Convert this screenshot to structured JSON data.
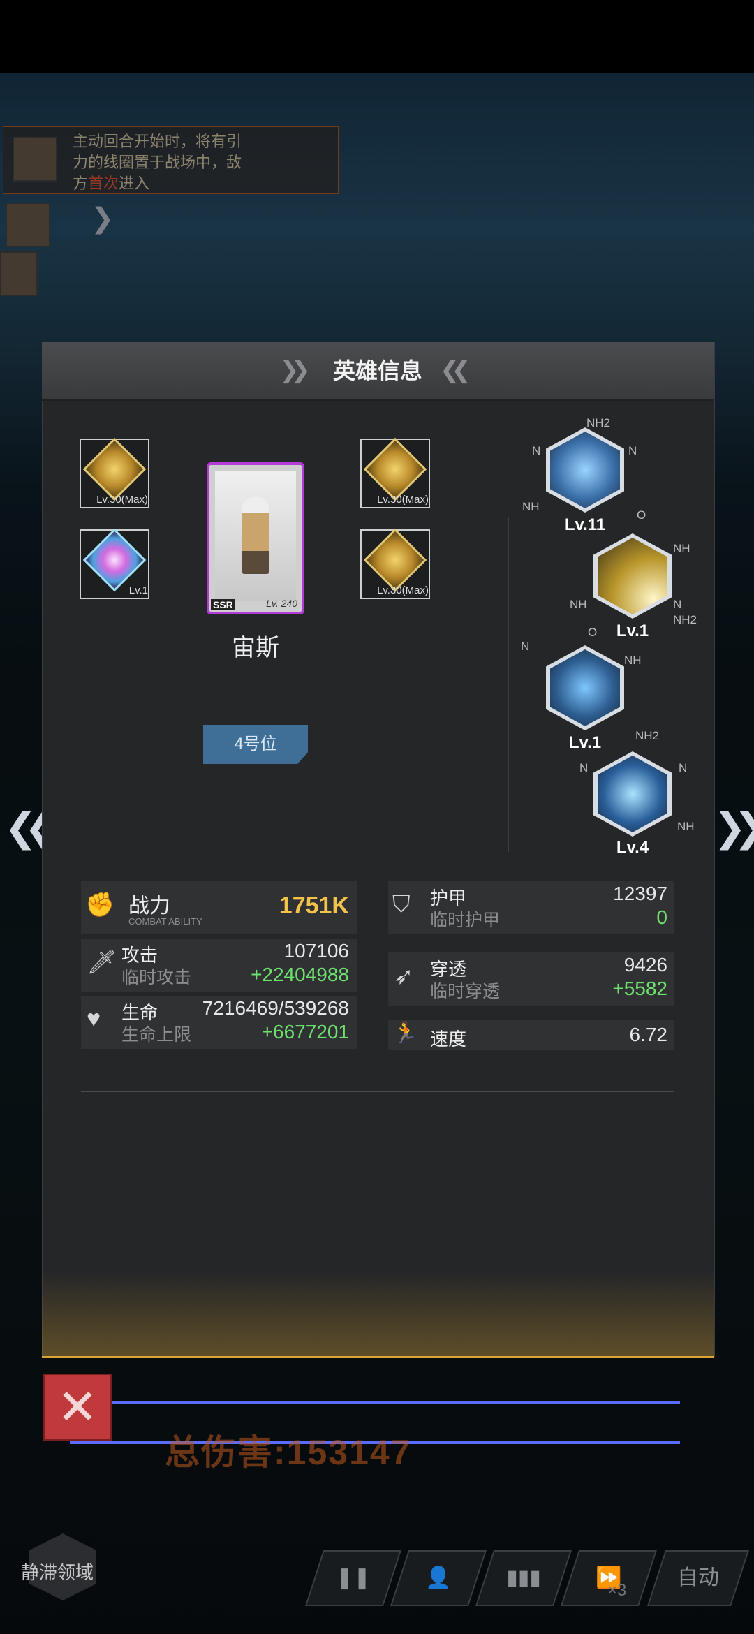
{
  "battle": {
    "skill_banner_pre": "主动回合开始时，将有引力的线圈置于战场中，敌方",
    "skill_banner_highlight": "首次",
    "skill_banner_post": "进入",
    "total_damage": "总伤害:153147",
    "field_label": "静滞领域",
    "auto_label": "自动",
    "speed_label": "×3"
  },
  "modal": {
    "title": "英雄信息",
    "hero": {
      "name": "宙斯",
      "rarity": "SSR",
      "level": "Lv. 240",
      "slot": "4号位"
    },
    "equipment": [
      {
        "level": "Lv.30(Max)",
        "style": "gold"
      },
      {
        "level": "Lv.1",
        "style": "rainbow"
      },
      {
        "level": "Lv.30(Max)",
        "style": "gold"
      },
      {
        "level": "Lv.30(Max)",
        "style": "gold"
      }
    ],
    "runes": [
      {
        "level": "Lv.11",
        "color": "#3a6fa8"
      },
      {
        "level": "Lv.1",
        "color": "#b8952a"
      },
      {
        "level": "Lv.1",
        "color": "#2d5d8f"
      },
      {
        "level": "Lv.4",
        "color": "#2a5f9a"
      }
    ],
    "chem_labels": [
      "NH2",
      "N",
      "N",
      "NH",
      "O",
      "NH",
      "NH",
      "N",
      "NH2",
      "N",
      "O",
      "NH",
      "NH2",
      "N",
      "N",
      "NH"
    ],
    "stats": {
      "power": {
        "label": "战力",
        "sub": "COMBAT ABILITY",
        "value": "1751K"
      },
      "armor": {
        "label": "护甲",
        "sub": "临时护甲",
        "value": "12397",
        "bonus": "0"
      },
      "attack": {
        "label": "攻击",
        "sub": "临时攻击",
        "value": "107106",
        "bonus": "+22404988"
      },
      "penetration": {
        "label": "穿透",
        "sub": "临时穿透",
        "value": "9426",
        "bonus": "+5582"
      },
      "life": {
        "label": "生命",
        "sub": "生命上限",
        "value": "7216469/539268",
        "bonus": "+6677201"
      },
      "speed": {
        "label": "速度",
        "value": "6.72"
      }
    }
  },
  "colors": {
    "accent_gold": "#f4c34a",
    "bonus_green": "#6fe06f",
    "close_red": "#c0393c",
    "card_border": "#b43bd8"
  }
}
